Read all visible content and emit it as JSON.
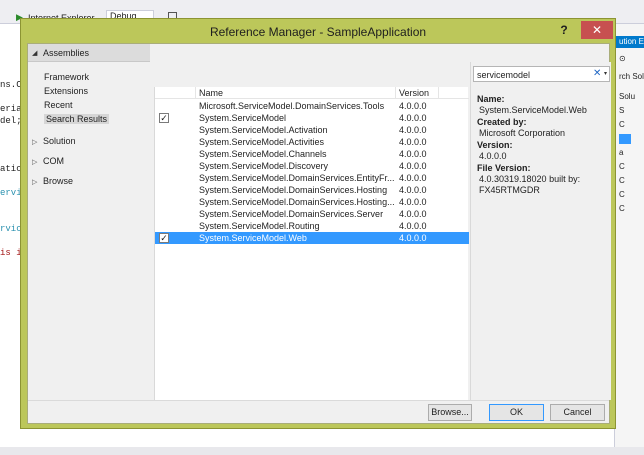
{
  "ide": {
    "run_target": "Internet Explorer",
    "configuration": "Debug",
    "code_lines": [
      {
        "text": "ns.C",
        "color": "#1e1e1e"
      },
      {
        "text": "eria",
        "color": "#1e1e1e"
      },
      {
        "text": "del;",
        "color": "#1e1e1e"
      },
      {
        "text": "atic",
        "color": "#1e1e1e"
      },
      {
        "text": "ervi",
        "color": "#2b91af"
      },
      {
        "text": "rvic",
        "color": "#2b91af"
      },
      {
        "text": "is i",
        "color": "#a31515"
      }
    ],
    "solution_explorer": {
      "title": "ution E",
      "search_hint": "rch Solu",
      "items": [
        "Solu",
        "S",
        "C",
        "a",
        "C",
        "C",
        "C",
        "C"
      ]
    }
  },
  "dialog": {
    "title": "Reference Manager - SampleApplication",
    "help_label": "?",
    "close_label": "✕",
    "nav": {
      "assemblies_label": "Assemblies",
      "assemblies_sub": [
        "Framework",
        "Extensions",
        "Recent",
        "Search Results"
      ],
      "selected_sub_index": 3,
      "groups": [
        "Solution",
        "COM",
        "Browse"
      ]
    },
    "list": {
      "columns": {
        "name": "Name",
        "version": "Version"
      },
      "rows": [
        {
          "name": "Microsoft.ServiceModel.DomainServices.Tools",
          "version": "4.0.0.0",
          "checked": false,
          "selected": false
        },
        {
          "name": "System.ServiceModel",
          "version": "4.0.0.0",
          "checked": true,
          "selected": false
        },
        {
          "name": "System.ServiceModel.Activation",
          "version": "4.0.0.0",
          "checked": false,
          "selected": false
        },
        {
          "name": "System.ServiceModel.Activities",
          "version": "4.0.0.0",
          "checked": false,
          "selected": false
        },
        {
          "name": "System.ServiceModel.Channels",
          "version": "4.0.0.0",
          "checked": false,
          "selected": false
        },
        {
          "name": "System.ServiceModel.Discovery",
          "version": "4.0.0.0",
          "checked": false,
          "selected": false
        },
        {
          "name": "System.ServiceModel.DomainServices.EntityFr...",
          "version": "4.0.0.0",
          "checked": false,
          "selected": false
        },
        {
          "name": "System.ServiceModel.DomainServices.Hosting",
          "version": "4.0.0.0",
          "checked": false,
          "selected": false
        },
        {
          "name": "System.ServiceModel.DomainServices.Hosting...",
          "version": "4.0.0.0",
          "checked": false,
          "selected": false
        },
        {
          "name": "System.ServiceModel.DomainServices.Server",
          "version": "4.0.0.0",
          "checked": false,
          "selected": false
        },
        {
          "name": "System.ServiceModel.Routing",
          "version": "4.0.0.0",
          "checked": false,
          "selected": false
        },
        {
          "name": "System.ServiceModel.Web",
          "version": "4.0.0.0",
          "checked": true,
          "selected": true
        }
      ]
    },
    "search": {
      "value": "servicemodel",
      "clear_icon": "✕",
      "dropdown_icon": "▾"
    },
    "details": {
      "name_label": "Name:",
      "name_value": "System.ServiceModel.Web",
      "created_by_label": "Created by:",
      "created_by_value": "Microsoft Corporation",
      "version_label": "Version:",
      "version_value": "4.0.0.0",
      "file_version_label": "File Version:",
      "file_version_line1": "4.0.30319.18020 built by:",
      "file_version_line2": "FX45RTMGDR"
    },
    "buttons": {
      "browse": "Browse...",
      "ok": "OK",
      "cancel": "Cancel"
    }
  }
}
